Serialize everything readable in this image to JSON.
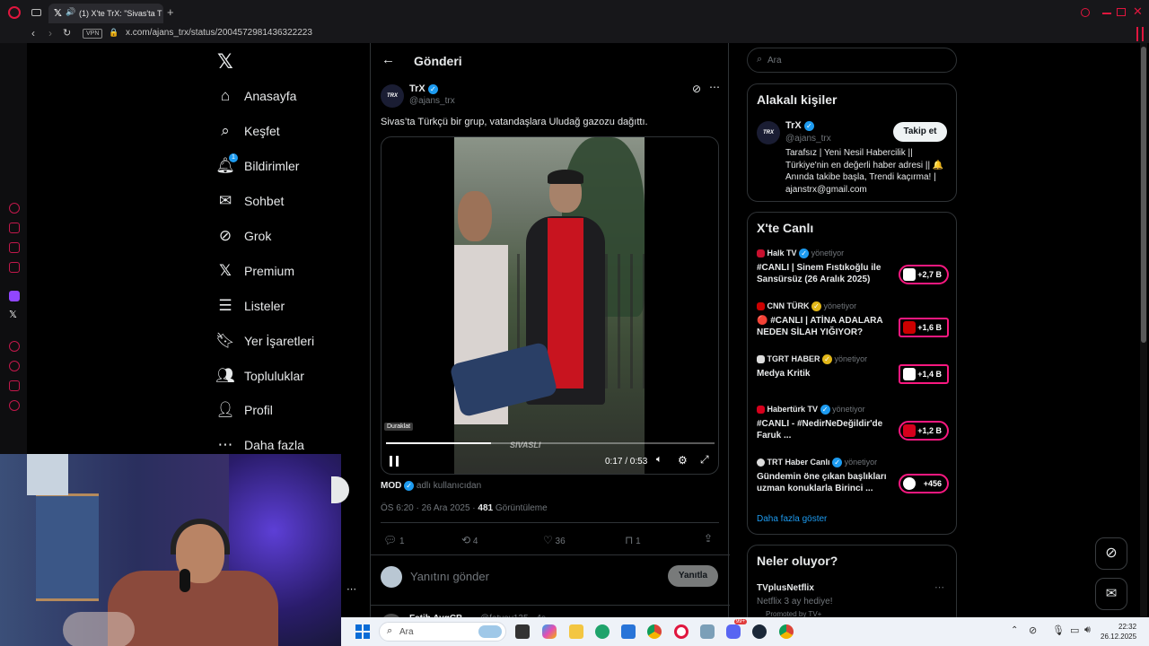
{
  "browser": {
    "tab_title": "(1) X'te TrX: \"Sivas'ta T",
    "vpn_label": "VPN",
    "url": "x.com/ajans_trx/status/2004572981436322223"
  },
  "nav": {
    "items": [
      {
        "label": "Anasayfa"
      },
      {
        "label": "Keşfet"
      },
      {
        "label": "Bildirimler",
        "badge": "1"
      },
      {
        "label": "Sohbet"
      },
      {
        "label": "Grok"
      },
      {
        "label": "Premium"
      },
      {
        "label": "Listeler"
      },
      {
        "label": "Yer İşaretleri"
      },
      {
        "label": "Topluluklar"
      },
      {
        "label": "Profil"
      },
      {
        "label": "Daha fazla"
      }
    ]
  },
  "post": {
    "header_title": "Gönderi",
    "author_name": "TrX",
    "author_handle": "@ajans_trx",
    "avatar_text": "TRX",
    "text": "Sivas’ta Türkçü bir grup, vatandaşlara Uludağ gazozu dağıttı.",
    "video": {
      "tooltip": "Duraklat",
      "time": "0:17 / 0:53",
      "progress": 0.32,
      "watermark": "SIVASLI"
    },
    "source_name": "MOD",
    "source_suffix": "adlı kullanıcıdan",
    "meta_time": "ÖS 6:20 · 26 Ara 2025 ·",
    "views_count": "481",
    "views_label": "Görüntüleme",
    "actions": {
      "replies": "1",
      "reposts": "4",
      "likes": "36",
      "bookmarks": "1"
    },
    "reply_placeholder": "Yanıtını gönder",
    "reply_button": "Yanıtla",
    "next_author": "Fatih AygCB",
    "next_handle": "@fatyay135 · 4s"
  },
  "sidebar": {
    "search_placeholder": "Ara",
    "related_title": "Alakalı kişiler",
    "related_name": "TrX",
    "related_handle": "@ajans_trx",
    "follow_label": "Takip et",
    "related_bio": "Tarafsız | Yeni Nesil Habercilik || Türkiye'nin en değerli haber adresi || 🔔 Anında takibe başla, Trendi kaçırma! | ajanstrx@gmail.com",
    "live_title": "X'te Canlı",
    "live_items": [
      {
        "channel": "Halk TV",
        "host_label": "yönetiyor",
        "title": "#CANLI | Sinem Fıstıkoğlu ile Sansürsüz (26 Aralık 2025)",
        "count": "+2,7 B",
        "accent": "#c8102e"
      },
      {
        "channel": "CNN TÜRK",
        "host_label": "yönetiyor",
        "title": "🔴 #CANLI | ATİNA ADALARA NEDEN SİLAH YIĞIYOR?",
        "count": "+1,6 B",
        "accent": "#cc0000"
      },
      {
        "channel": "TGRT HABER",
        "host_label": "yönetiyor",
        "title": "Medya Kritik",
        "count": "+1,4 B",
        "accent": "#1f3c88"
      },
      {
        "channel": "Habertürk TV",
        "host_label": "yönetiyor",
        "title": "#CANLI - #NedirNeDeğildir'de Faruk ...",
        "count": "+1,2 B",
        "accent": "#d6001c"
      },
      {
        "channel": "TRT Haber Canlı",
        "host_label": "yönetiyor",
        "title": "Gündemin öne çıkan başlıkları uzman konuklarla Birinci ...",
        "count": "+456",
        "accent": "#e30a17"
      }
    ],
    "show_more": "Daha fazla göster",
    "trends_title": "Neler oluyor?",
    "trend_name": "TVplusNetflix",
    "trend_desc": "Netflix 3 ay hediye!",
    "trend_promo": "Promoted by TV+"
  },
  "taskbar": {
    "search_label": "Ara",
    "time": "22:32",
    "date": "26.12.2025",
    "notif_badge": "99+"
  },
  "colors": {
    "accent_pink": "#f91880",
    "x_blue": "#1d9bf0",
    "opera_red": "#c2184b"
  }
}
